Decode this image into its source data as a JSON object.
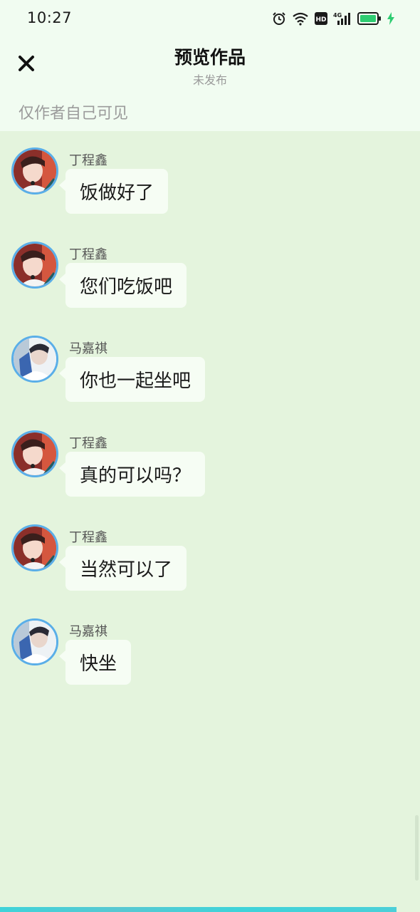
{
  "status_bar": {
    "time": "10:27",
    "network": "4G",
    "hd_label": "HD",
    "icons": [
      "alarm-icon",
      "wifi-icon",
      "hd-icon",
      "signal-4g-icon",
      "battery-icon",
      "charging-bolt-icon"
    ],
    "battery_color": "#2ecc71"
  },
  "header": {
    "close_icon": "close-icon",
    "title": "预览作品",
    "subtitle": "未发布",
    "visibility_note": "仅作者自己可见"
  },
  "messages": [
    {
      "sender": "丁程鑫",
      "text": "饭做好了",
      "avatar": "avatar-dingchengxin"
    },
    {
      "sender": "丁程鑫",
      "text": "您们吃饭吧",
      "avatar": "avatar-dingchengxin"
    },
    {
      "sender": "马嘉祺",
      "text": "你也一起坐吧",
      "avatar": "avatar-majiaqi"
    },
    {
      "sender": "丁程鑫",
      "text": "真的可以吗？",
      "avatar": "avatar-dingchengxin"
    },
    {
      "sender": "丁程鑫",
      "text": "当然可以了",
      "avatar": "avatar-dingchengxin"
    },
    {
      "sender": "马嘉祺",
      "text": "快坐",
      "avatar": "avatar-majiaqi"
    }
  ],
  "colors": {
    "background": "#e4f4dd",
    "header_background": "#f1fcf1",
    "bubble": "#f6fdf4",
    "avatar_ring": "#5aaee8",
    "bottom_strip": "#3fd3d9"
  }
}
